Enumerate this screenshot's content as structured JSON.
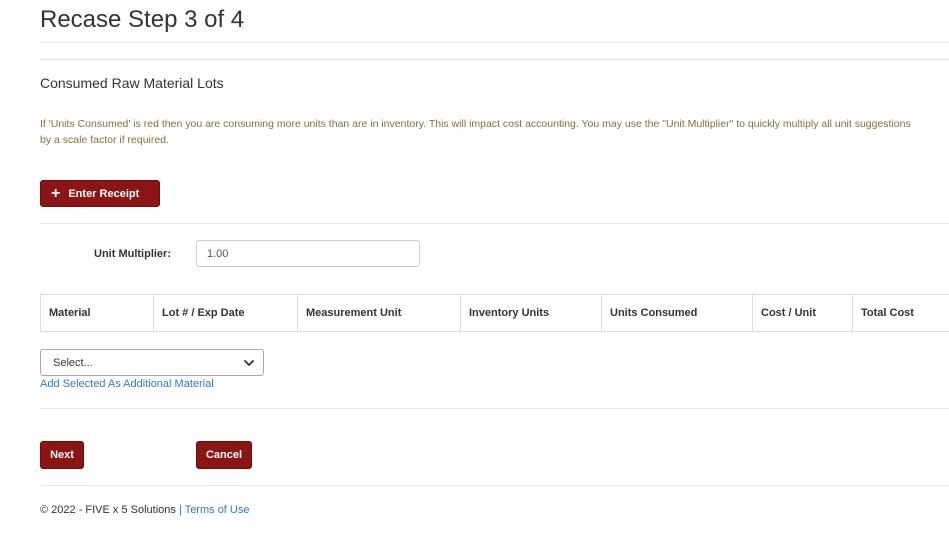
{
  "page": {
    "title": "Recase Step 3 of 4"
  },
  "section": {
    "title": "Consumed Raw Material Lots",
    "help_text": "If 'Units Consumed' is red then you are consuming more units than are in inventory. This will impact cost accounting. You may use the \"Unit Multiplier\" to quickly multiply all unit suggestions by a scale factor if required."
  },
  "buttons": {
    "enter_receipt": "Enter Receipt",
    "next": "Next",
    "cancel": "Cancel"
  },
  "multiplier": {
    "label": "Unit Multiplier:",
    "value": "1.00"
  },
  "table": {
    "columns": [
      "Material",
      "Lot # / Exp Date",
      "Measurement Unit",
      "Inventory Units",
      "Units Consumed",
      "Cost / Unit",
      "Total Cost"
    ]
  },
  "material_select": {
    "selected": "Select...",
    "add_link": "Add Selected As Additional Material"
  },
  "footer": {
    "copyright": "© 2022 - FIVE x 5 Solutions",
    "separator": "|",
    "terms_link": "Terms of Use"
  },
  "colors": {
    "brand_red": "#8b1414",
    "link_blue": "#337ab7",
    "warning_text": "#8a6d3b"
  }
}
